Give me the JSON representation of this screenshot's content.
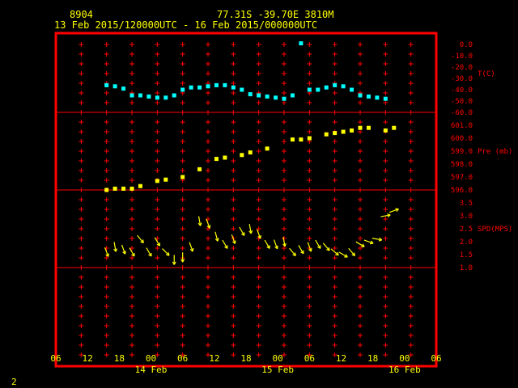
{
  "header": {
    "station": "8904",
    "location": "77.31S   -39.70E   3810M",
    "period": "13 Feb 2015/120000UTC - 16 Feb 2015/000000UTC"
  },
  "footer": {
    "page_number": "2"
  },
  "colors": {
    "background": "#000000",
    "frame": "#ff0000",
    "header_text": "#ffff00",
    "temperature": "#00ffff",
    "pressure": "#ffff00",
    "wind": "#ffff00",
    "axis_text": "#ff0000"
  },
  "chart_data": [
    {
      "type": "scatter",
      "panel": "temperature",
      "ylabel": "T(C)",
      "ylim": [
        -60,
        0
      ],
      "yticks": [
        "0.0",
        "-10.0",
        "-20.0",
        "-30.0",
        "-40.0",
        "-50.0",
        "-60.0"
      ],
      "x_unit": "hours after 13 Feb 2015 06 UTC",
      "x": [
        12,
        14,
        16,
        18,
        20,
        22,
        24,
        26,
        28,
        30,
        32,
        34,
        36,
        38,
        40,
        42,
        44,
        46,
        48,
        50,
        52,
        54,
        56,
        58,
        60,
        62,
        64,
        66,
        68,
        70,
        72,
        74,
        76,
        78
      ],
      "values": [
        -36,
        -37,
        -39,
        -45,
        -45,
        -46,
        -47,
        -47,
        -45,
        -40,
        -38,
        -38,
        -37,
        -36,
        -36,
        -38,
        -40,
        -44,
        -45,
        -46,
        -47,
        -48,
        -45,
        1,
        -40,
        -40,
        -38,
        -36,
        -37,
        -40,
        -45,
        -46,
        -47,
        -48
      ]
    },
    {
      "type": "scatter",
      "panel": "pressure",
      "ylabel": "Pre (mb)",
      "ylim": [
        596,
        601
      ],
      "yticks": [
        "596.0",
        "597.0",
        "598.0",
        "599.0",
        "600.0",
        "601.0"
      ],
      "x_unit": "hours after 13 Feb 2015 06 UTC",
      "x": [
        12,
        14,
        16,
        18,
        20,
        24,
        26,
        30,
        34,
        38,
        40,
        44,
        46,
        50,
        56,
        58,
        60,
        64,
        66,
        68,
        70,
        72,
        74,
        78,
        80
      ],
      "values": [
        596.0,
        596.1,
        596.1,
        596.1,
        596.3,
        596.7,
        596.8,
        597.0,
        597.6,
        598.4,
        598.5,
        598.7,
        598.9,
        599.2,
        599.9,
        599.9,
        600.0,
        600.3,
        600.4,
        600.5,
        600.6,
        600.8,
        600.8,
        600.6,
        600.8
      ]
    },
    {
      "type": "scatter",
      "panel": "wind_speed",
      "ylabel": "SPD(MPS)",
      "ylim": [
        1.0,
        3.5
      ],
      "yticks": [
        "1.0",
        "1.5",
        "2.0",
        "2.5",
        "3.0",
        "3.5"
      ],
      "x_unit": "hours after 13 Feb 2015 06 UTC",
      "x": [
        12,
        14,
        16,
        18,
        20,
        22,
        24,
        26,
        28,
        30,
        32,
        34,
        36,
        38,
        40,
        42,
        44,
        46,
        48,
        50,
        52,
        54,
        56,
        58,
        60,
        62,
        64,
        66,
        68,
        70,
        72,
        74,
        76,
        78,
        80
      ],
      "values": [
        1.6,
        1.8,
        1.7,
        1.6,
        2.1,
        1.6,
        2.0,
        1.6,
        1.3,
        1.4,
        1.8,
        2.8,
        2.7,
        2.2,
        1.9,
        2.1,
        2.4,
        2.5,
        2.3,
        1.9,
        1.9,
        2.0,
        1.6,
        1.7,
        1.8,
        1.9,
        1.8,
        1.6,
        1.5,
        1.6,
        1.9,
        2.0,
        2.1,
        3.0,
        3.2
      ],
      "directions_deg": [
        20,
        10,
        20,
        30,
        40,
        30,
        30,
        45,
        0,
        0,
        20,
        10,
        20,
        15,
        30,
        20,
        30,
        10,
        20,
        30,
        20,
        10,
        40,
        30,
        20,
        30,
        40,
        50,
        60,
        40,
        60,
        70,
        80,
        100,
        110
      ]
    }
  ],
  "x_axis": {
    "tick_labels": [
      "06",
      "12",
      "18",
      "00",
      "06",
      "12",
      "18",
      "00",
      "06",
      "12",
      "18",
      "00",
      "06"
    ],
    "date_labels": [
      "14 Feb",
      "15 Feb",
      "16 Feb"
    ]
  }
}
